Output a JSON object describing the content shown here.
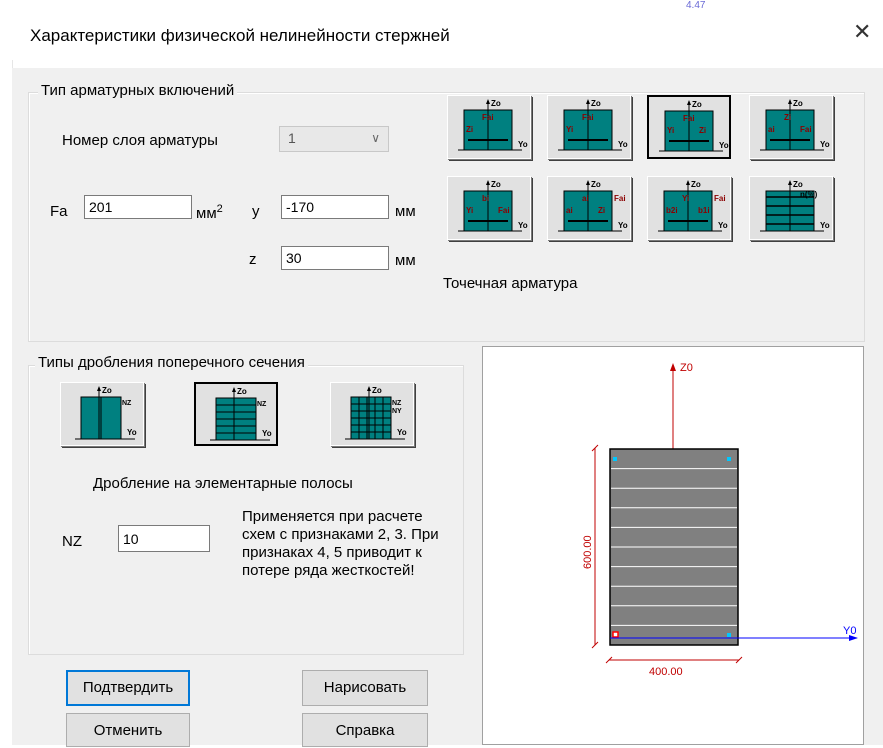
{
  "window": {
    "title": "Характеристики физической нелинейности стержней",
    "bg_hint": "4.47"
  },
  "reinforcement": {
    "group_label": "Тип арматурных включений",
    "layer_label": "Номер слоя арматуры",
    "layer_value": "1",
    "fa_label": "Fa",
    "fa_value": "201",
    "fa_unit": "мм",
    "fa_unit_sup": "2",
    "y_label": "y",
    "y_value": "-170",
    "y_unit": "мм",
    "z_label": "z",
    "z_value": "30",
    "z_unit": "мм",
    "type_caption": "Точечная арматура",
    "icons": [
      {
        "name": "rebar-type-1-icon",
        "t": [
          "Zo",
          "Zi",
          "Fai",
          "Yo"
        ]
      },
      {
        "name": "rebar-type-2-icon",
        "t": [
          "Zo",
          "Yi",
          "Fai",
          "Yo"
        ]
      },
      {
        "name": "rebar-type-3-icon",
        "t": [
          "Zo",
          "Yi",
          "Fai",
          "Zi",
          "Yo"
        ]
      },
      {
        "name": "rebar-type-4-icon",
        "t": [
          "Zo",
          "ai",
          "Zi",
          "Fai",
          "Yo"
        ]
      },
      {
        "name": "rebar-type-5-icon",
        "t": [
          "Zo",
          "Yi",
          "bi",
          "Fai",
          "Yo"
        ]
      },
      {
        "name": "rebar-type-6-icon",
        "t": [
          "Zo",
          "ai",
          "ai",
          "Zi",
          "Fai",
          "Yo"
        ]
      },
      {
        "name": "rebar-type-7-icon",
        "t": [
          "Zo",
          "b2i",
          "Yi",
          "b1i",
          "Fai",
          "Yo"
        ]
      },
      {
        "name": "rebar-type-8-icon",
        "t": [
          "Zo",
          "n(%)",
          "Yo"
        ]
      }
    ]
  },
  "split": {
    "group_label": "Типы дробления поперечного сечения",
    "caption": "Дробление на элементарные полосы",
    "nz_label": "NZ",
    "nz_value": "10",
    "note": "Применяется при расчете схем с признаками 2, 3.     При признаках 4, 5 приводит к потере ряда жесткостей!",
    "icons": [
      {
        "name": "split-vertical-strips-icon",
        "t": [
          "Zo",
          "NZ",
          "Yo"
        ]
      },
      {
        "name": "split-horizontal-strips-icon",
        "t": [
          "Zo",
          "NZ",
          "Yo"
        ]
      },
      {
        "name": "split-grid-icon",
        "t": [
          "Zo",
          "NZ",
          "NY",
          "Yo"
        ]
      }
    ]
  },
  "preview": {
    "z_axis": "Z0",
    "y_axis": "Y0",
    "height_dim": "600.00",
    "width_dim": "400.00"
  },
  "buttons": {
    "confirm": "Подтвердить",
    "draw": "Нарисовать",
    "cancel": "Отменить",
    "help": "Справка"
  },
  "colors": {
    "teal": "#008080",
    "accent": "#0078d7",
    "dim_red": "#c00000",
    "axis_blue": "#0000ff"
  }
}
